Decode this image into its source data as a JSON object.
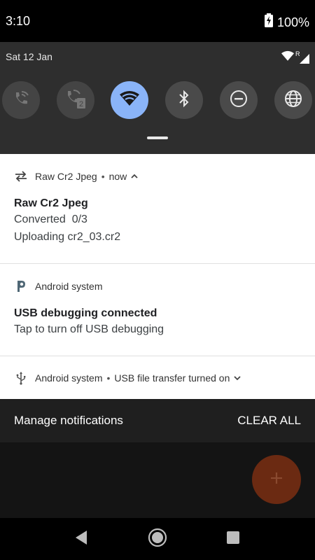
{
  "status_bar": {
    "time": "3:10",
    "battery": "100%",
    "battery_icon": "battery-charging-icon"
  },
  "quick_settings": {
    "date": "Sat 12 Jan",
    "indicators": [
      "wifi-icon",
      "signal-icon"
    ],
    "signal_badge": "R",
    "tiles": [
      {
        "icon": "wifi-calling-icon",
        "active": false
      },
      {
        "icon": "wifi-calling-2-icon",
        "active": false
      },
      {
        "icon": "wifi-icon",
        "active": true
      },
      {
        "icon": "bluetooth-icon",
        "active": false
      },
      {
        "icon": "do-not-disturb-icon",
        "active": false
      },
      {
        "icon": "globe-icon",
        "active": false
      }
    ],
    "accent": "#8ab4f8"
  },
  "notifications": [
    {
      "app": "Raw Cr2 Jpeg",
      "time": "now",
      "title": "Raw Cr2 Jpeg",
      "lines": [
        "Converted  0/3",
        "Uploading cr2_03.cr2"
      ]
    },
    {
      "app": "Android system",
      "title": "USB debugging connected",
      "text": "Tap to turn off USB debugging"
    },
    {
      "app": "Android system",
      "summary": "USB file transfer turned on"
    }
  ],
  "footer": {
    "manage": "Manage notifications",
    "clear_all": "CLEAR ALL"
  },
  "fab": {
    "icon": "plus-icon",
    "color": "#6b2a12"
  },
  "nav": [
    "back-icon",
    "home-icon",
    "recents-icon"
  ]
}
